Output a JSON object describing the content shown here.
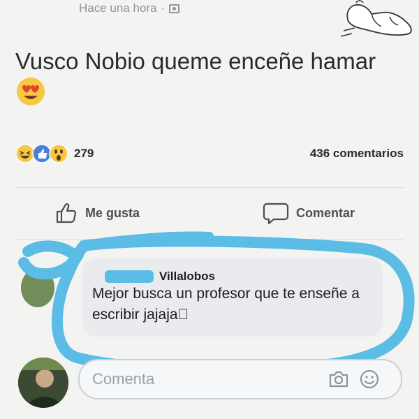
{
  "post": {
    "timestamp": "Hace una hora",
    "separator": "·",
    "text": "Vusco Nobio queme enceñe hamar"
  },
  "stats": {
    "reaction_count": "279",
    "comment_count": "436 comentarios"
  },
  "actions": {
    "like_label": "Me gusta",
    "comment_label": "Comentar"
  },
  "comment": {
    "author": "Villalobos",
    "text": "Mejor busca un profesor que te enseñe a escribir jajaja⃞"
  },
  "composer": {
    "placeholder": "Comenta"
  },
  "colors": {
    "highlight": "#5bbde6",
    "like_blue": "#4a7fe0",
    "emoji_yellow": "#f7c844"
  },
  "icons": {
    "visibility": "audience-icon",
    "like": "thumbs-up-icon",
    "comment": "speech-bubble-icon",
    "camera": "camera-icon",
    "emoji": "smiley-icon"
  }
}
